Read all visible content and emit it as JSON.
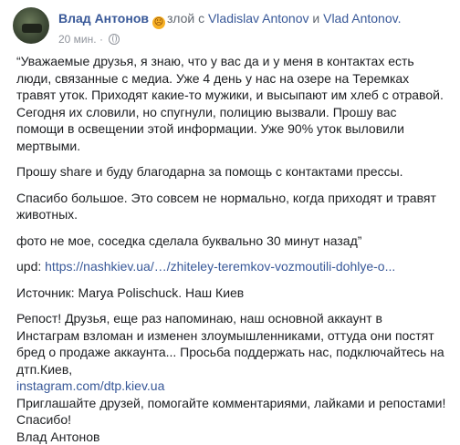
{
  "post": {
    "author": "Влад Антонов",
    "feeling": "злой",
    "with_prefix": "с",
    "tag1": "Vladislav Antonov",
    "and": "и",
    "tag2": "Vlad Antonov.",
    "time": "20 мин.",
    "time_sep": "·"
  },
  "body": {
    "p1": "“Уважаемые друзья, я знаю, что у вас да и у меня в контактах есть люди, связанные с медиа. Уже 4 день у нас на озере на Теремках травят уток. Приходят какие-то мужики, и высыпают им хлеб с отравой. Сегодня их словили, но спугнули, полицию вызвали. Прошу вас помощи в освещении этой информации. Уже 90% уток выловили мертвыми.",
    "p2": "Прошу share и буду благодарна за помощь с контактами прессы.",
    "p3": "Спасибо большое. Это совсем не нормально, когда приходят и травят животных.",
    "p4": "фото не мое, соседка сделала буквально 30 минут назад”",
    "upd_label": "upd:",
    "upd_link": "https://nashkiev.ua/…/zhiteley-teremkov-vozmoutili-dohlye-o...",
    "source": "Источник: Marya Polischuck. Наш Киев",
    "repost": "Репост! Друзья, еще раз напоминаю, наш основной аккаунт в Инстаграм взломан и изменен злоумышленниками, оттуда они постят бред о продаже аккаунта... Просьба поддержать нас, подключайтесь на дтп.Киев,",
    "insta_link": "instagram.com/dtp.kiev.ua",
    "invite": "Приглашайте друзей, помогайте комментариями, лайками и репостами!",
    "thanks": "Спасибо!",
    "signature": "Влад Антонов"
  },
  "icons": {
    "feeling": "angry-face-icon",
    "privacy": "globe-icon",
    "avatar": "user-avatar"
  }
}
